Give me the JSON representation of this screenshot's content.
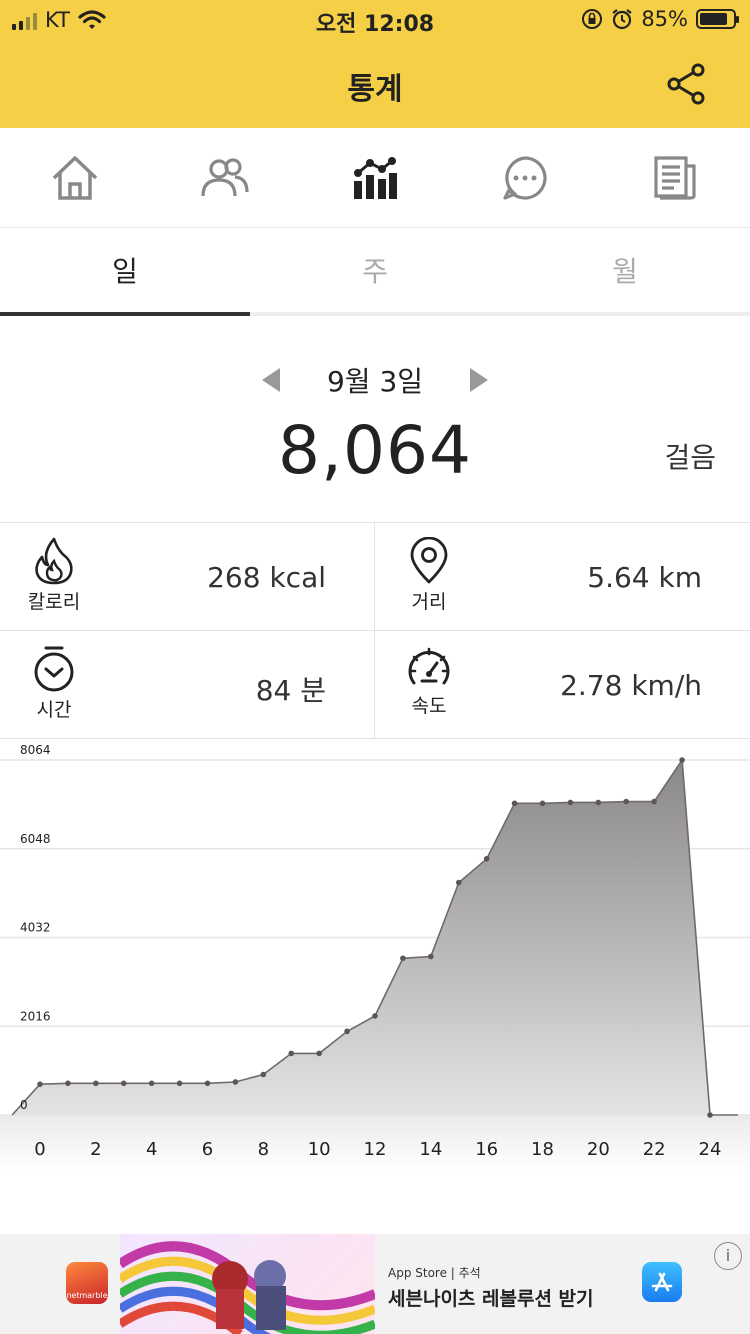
{
  "status_bar": {
    "carrier": "KT",
    "time": "오전 12:08",
    "battery_percent": "85%",
    "battery_level": 0.85,
    "icons": [
      "signal-icon",
      "wifi-icon",
      "rotation-lock-icon",
      "alarm-icon",
      "battery-icon"
    ]
  },
  "header": {
    "title": "통계",
    "share_icon": "share-icon",
    "background": "#f5cf45"
  },
  "menu": {
    "items": [
      {
        "icon": "home-icon"
      },
      {
        "icon": "friends-icon"
      },
      {
        "icon": "statistics-icon",
        "active": true
      },
      {
        "icon": "chat-icon"
      },
      {
        "icon": "news-icon"
      }
    ]
  },
  "tabs": [
    {
      "label": "일",
      "active": true
    },
    {
      "label": "주",
      "active": false
    },
    {
      "label": "월",
      "active": false
    }
  ],
  "summary": {
    "date": "9월 3일",
    "steps": "8,064",
    "steps_unit": "걸음"
  },
  "stats": [
    {
      "label": "칼로리",
      "value": "268 kcal",
      "icon": "flame-icon"
    },
    {
      "label": "거리",
      "value": "5.64 km",
      "icon": "location-pin-icon"
    },
    {
      "label": "시간",
      "value": "84 분",
      "icon": "stopwatch-icon"
    },
    {
      "label": "속도",
      "value": "2.78 km/h",
      "icon": "speedometer-icon"
    }
  ],
  "chart_data": {
    "type": "area",
    "x": [
      -1,
      0,
      1,
      2,
      3,
      4,
      5,
      6,
      7,
      8,
      9,
      10,
      11,
      12,
      13,
      14,
      15,
      16,
      17,
      18,
      19,
      20,
      21,
      22,
      23,
      24,
      25
    ],
    "values": [
      0,
      700,
      720,
      720,
      720,
      720,
      720,
      720,
      750,
      920,
      1400,
      1400,
      1900,
      2250,
      3560,
      3600,
      5280,
      5820,
      7080,
      7080,
      7100,
      7100,
      7120,
      7120,
      8064,
      0,
      0
    ],
    "xticks": [
      "0",
      "2",
      "4",
      "6",
      "8",
      "10",
      "12",
      "14",
      "16",
      "18",
      "20",
      "22",
      "24"
    ],
    "yticks": [
      "0",
      "2016",
      "4032",
      "6048",
      "8064"
    ],
    "ylim": [
      0,
      8064
    ],
    "grid": true
  },
  "ad": {
    "app_store_text": "App Store | 추석",
    "headline": "세븐나이츠 레볼루션 받기",
    "app_icon_text": "netmarble",
    "info_label": "i"
  }
}
